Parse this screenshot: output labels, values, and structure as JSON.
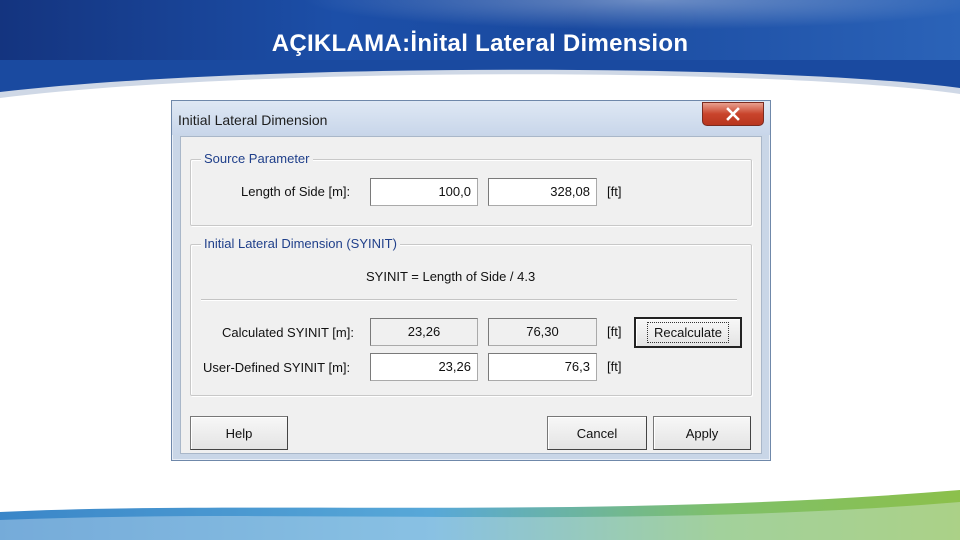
{
  "slide": {
    "title": "AÇIKLAMA:İnital Lateral Dimension"
  },
  "dialog": {
    "title": "Initial Lateral Dimension",
    "source_group": {
      "legend": "Source Parameter",
      "length_label": "Length of Side [m]:",
      "length_m": "100,0",
      "length_ft": "328,08",
      "unit_ft": "[ft]"
    },
    "syinit_group": {
      "legend": "Initial Lateral Dimension (SYINIT)",
      "formula": "SYINIT = Length of Side / 4.3",
      "calculated_label": "Calculated SYINIT [m]:",
      "calculated_m": "23,26",
      "calculated_ft": "76,30",
      "calculated_unit": "[ft]",
      "recalculate_label": "Recalculate",
      "user_label": "User-Defined SYINIT [m]:",
      "user_m": "23,26",
      "user_ft": "76,3",
      "user_unit": "[ft]"
    },
    "buttons": {
      "help": "Help",
      "cancel": "Cancel",
      "apply": "Apply"
    }
  },
  "colors": {
    "header_blue": "#1c4fa8",
    "legend_blue": "#1f3f8a",
    "close_red": "#c9442c",
    "footer_green": "#8cc04b"
  }
}
